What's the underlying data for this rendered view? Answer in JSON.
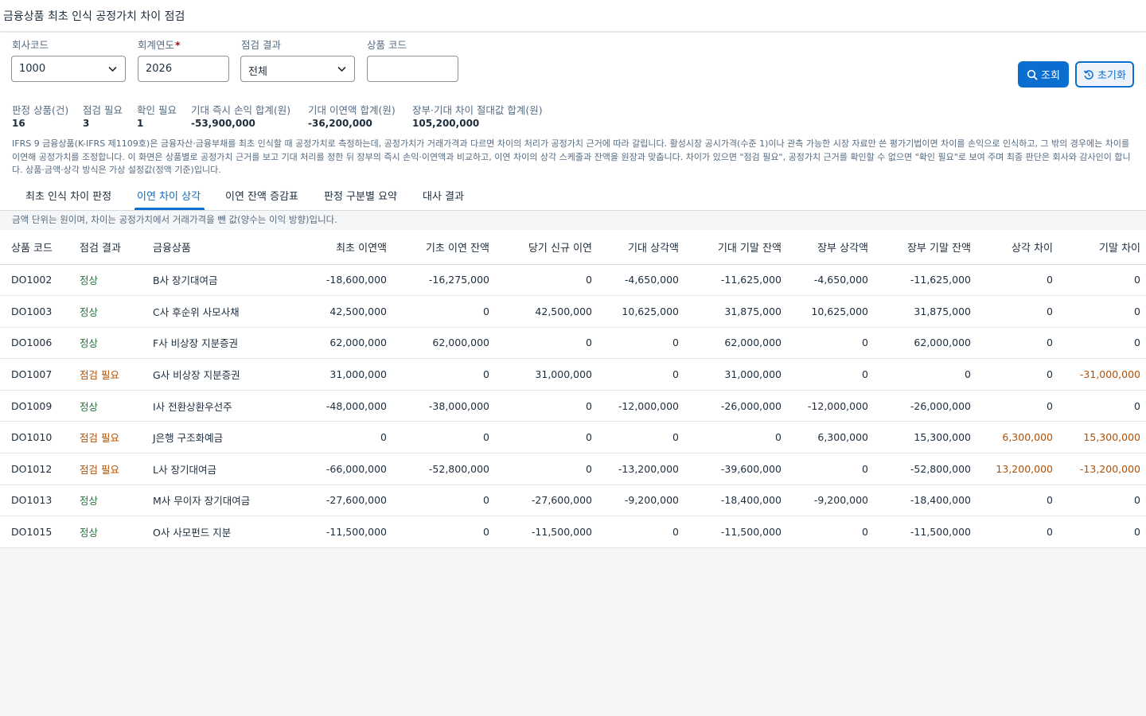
{
  "app": {
    "title": "금융상품 최초 인식 공정가치 차이 점검"
  },
  "filters": {
    "company_label": "회사코드",
    "company_value": "1000",
    "year_label": "회계연도",
    "year_required": "*",
    "year_value": "2026",
    "result_label": "점검 결과",
    "result_value": "전체",
    "product_label": "상품 코드",
    "product_value": ""
  },
  "actions": {
    "search": "조회",
    "reset": "초기화"
  },
  "kpis": [
    {
      "label": "판정 상품(건)",
      "value": "16"
    },
    {
      "label": "점검 필요",
      "value": "3"
    },
    {
      "label": "확인 필요",
      "value": "1"
    },
    {
      "label": "기대 즉시 손익 합계(원)",
      "value": "-53,900,000"
    },
    {
      "label": "기대 이연액 합계(원)",
      "value": "-36,200,000"
    },
    {
      "label": "장부·기대 차이 절대값 합계(원)",
      "value": "105,200,000"
    }
  ],
  "description": "IFRS 9 금융상품(K-IFRS 제1109호)은 금융자산·금융부채를 최초 인식할 때 공정가치로 측정하는데, 공정가치가 거래가격과 다르면 차이의 처리가 공정가치 근거에 따라 갈립니다. 활성시장 공시가격(수준 1)이나 관측 가능한 시장 자료만 쓴 평가기법이면 차이를 손익으로 인식하고, 그 밖의 경우에는 차이를 이연해 공정가치를 조정합니다. 이 화면은 상품별로 공정가치 근거를 보고 기대 처리를 정한 뒤 장부의 즉시 손익·이연액과 비교하고, 이연 차이의 상각 스케줄과 잔액을 원장과 맞춥니다. 차이가 있으면 \"점검 필요\", 공정가치 근거를 확인할 수 없으면 \"확인 필요\"로 보여 주며 최종 판단은 회사와 감사인이 합니다. 상품·금액·상각 방식은 가상 설정값(정액 기준)입니다.",
  "tabs": [
    {
      "label": "최초 인식 차이 판정",
      "active": false
    },
    {
      "label": "이연 차이 상각",
      "active": true
    },
    {
      "label": "이연 잔액 증감표",
      "active": false
    },
    {
      "label": "판정 구분별 요약",
      "active": false
    },
    {
      "label": "대사 결과",
      "active": false
    }
  ],
  "note": "금액 단위는 원이며, 차이는 공정가치에서 거래가격을 뺀 값(양수는 이익 방향)입니다.",
  "table": {
    "columns": [
      "상품 코드",
      "점검 결과",
      "금융상품",
      "최초 이연액",
      "기초 이연 잔액",
      "당기 신규 이연",
      "기대 상각액",
      "기대 기말 잔액",
      "장부 상각액",
      "장부 기말 잔액",
      "상각 차이",
      "기말 차이"
    ],
    "rows": [
      {
        "code": "DO1002",
        "result": "정상",
        "status": "ok",
        "name": "B사 장기대여금",
        "initial": "-18,600,000",
        "opening": "-16,275,000",
        "new": "0",
        "exp_amort": "-4,650,000",
        "exp_end": "-11,625,000",
        "book_amort": "-4,650,000",
        "book_end": "-11,625,000",
        "amort_diff": "0",
        "end_diff": "0"
      },
      {
        "code": "DO1003",
        "result": "정상",
        "status": "ok",
        "name": "C사 후순위 사모사채",
        "initial": "42,500,000",
        "opening": "0",
        "new": "42,500,000",
        "exp_amort": "10,625,000",
        "exp_end": "31,875,000",
        "book_amort": "10,625,000",
        "book_end": "31,875,000",
        "amort_diff": "0",
        "end_diff": "0"
      },
      {
        "code": "DO1006",
        "result": "정상",
        "status": "ok",
        "name": "F사 비상장 지분증권",
        "initial": "62,000,000",
        "opening": "62,000,000",
        "new": "0",
        "exp_amort": "0",
        "exp_end": "62,000,000",
        "book_amort": "0",
        "book_end": "62,000,000",
        "amort_diff": "0",
        "end_diff": "0"
      },
      {
        "code": "DO1007",
        "result": "점검 필요",
        "status": "warn",
        "name": "G사 비상장 지분증권",
        "initial": "31,000,000",
        "opening": "0",
        "new": "31,000,000",
        "exp_amort": "0",
        "exp_end": "31,000,000",
        "book_amort": "0",
        "book_end": "0",
        "amort_diff": "0",
        "end_diff": "-31,000,000"
      },
      {
        "code": "DO1009",
        "result": "정상",
        "status": "ok",
        "name": "I사 전환상환우선주",
        "initial": "-48,000,000",
        "opening": "-38,000,000",
        "new": "0",
        "exp_amort": "-12,000,000",
        "exp_end": "-26,000,000",
        "book_amort": "-12,000,000",
        "book_end": "-26,000,000",
        "amort_diff": "0",
        "end_diff": "0"
      },
      {
        "code": "DO1010",
        "result": "점검 필요",
        "status": "warn",
        "name": "J은행 구조화예금",
        "initial": "0",
        "opening": "0",
        "new": "0",
        "exp_amort": "0",
        "exp_end": "0",
        "book_amort": "6,300,000",
        "book_end": "15,300,000",
        "amort_diff": "6,300,000",
        "end_diff": "15,300,000"
      },
      {
        "code": "DO1012",
        "result": "점검 필요",
        "status": "warn",
        "name": "L사 장기대여금",
        "initial": "-66,000,000",
        "opening": "-52,800,000",
        "new": "0",
        "exp_amort": "-13,200,000",
        "exp_end": "-39,600,000",
        "book_amort": "0",
        "book_end": "-52,800,000",
        "amort_diff": "13,200,000",
        "end_diff": "-13,200,000"
      },
      {
        "code": "DO1013",
        "result": "정상",
        "status": "ok",
        "name": "M사 무이자 장기대여금",
        "initial": "-27,600,000",
        "opening": "0",
        "new": "-27,600,000",
        "exp_amort": "-9,200,000",
        "exp_end": "-18,400,000",
        "book_amort": "-9,200,000",
        "book_end": "-18,400,000",
        "amort_diff": "0",
        "end_diff": "0"
      },
      {
        "code": "DO1015",
        "result": "정상",
        "status": "ok",
        "name": "O사 사모펀드 지분",
        "initial": "-11,500,000",
        "opening": "0",
        "new": "-11,500,000",
        "exp_amort": "0",
        "exp_end": "-11,500,000",
        "book_amort": "0",
        "book_end": "-11,500,000",
        "amort_diff": "0",
        "end_diff": "0"
      }
    ]
  },
  "colors": {
    "accent": "#0a6ed1",
    "ok": "#256f3a",
    "warn": "#b44f00",
    "required": "#aa0808"
  },
  "icons": {
    "search": "search-icon",
    "reset": "reset-icon",
    "dropdown": "chevron-down-icon"
  }
}
